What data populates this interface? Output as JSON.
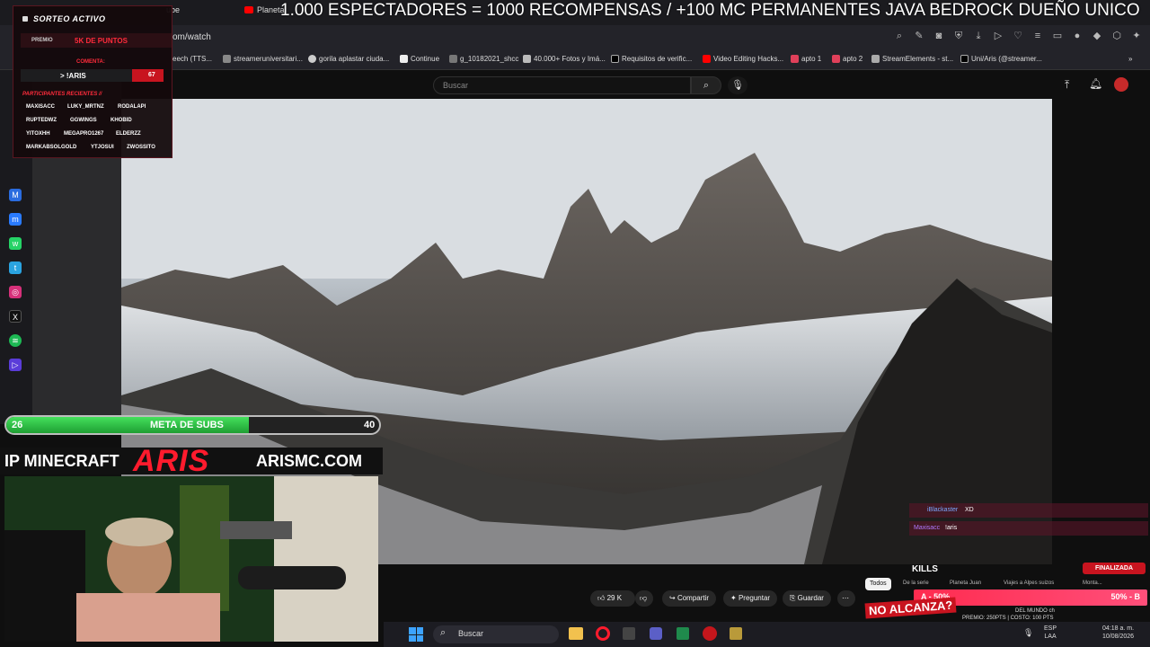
{
  "banner": "1.000 ESPECTADORES = 1000 RECOMPENSAS / +100 MC PERMANENTES JAVA BEDROCK DUEÑO UNICO",
  "tabs": [
    "ube",
    "Planeta"
  ],
  "url": "om/watch",
  "bookmarks": [
    "eech (TTS...",
    "streameruniversitari...",
    "gorila aplastar ciuda...",
    "Continue",
    "g_10182021_shcc",
    "40.000+ Fotos y Imá...",
    "Requisitos de verific...",
    "Video Editing Hacks...",
    "apto 1",
    "apto 2",
    "StreamElements - st...",
    "Uni/Aris (@streamer..."
  ],
  "youtube": {
    "search_placeholder": "Buscar"
  },
  "actions": {
    "likes": "29 K",
    "share": "Compartir",
    "ask": "Preguntar",
    "save": "Guardar"
  },
  "chips": [
    "Todos",
    "De la serie",
    "Planeta Juan",
    "Viajes a Alpes suizos",
    "Monta..."
  ],
  "sorteo": {
    "title": "SORTEO ACTIVO",
    "premio_label": "PREMIO",
    "premio_value": "5K DE PUNTOS",
    "comenta_label": "COMENTA:",
    "command": "> !ARIS",
    "count": "67",
    "participants_label": "PARTICIPANTES RECIENTES //",
    "participants": [
      "MAXISACC",
      "LUKY_MRTNZ",
      "RODALAPI",
      "RUPTEDWZ",
      "GGWINGS",
      "KHOBID",
      "YITOXHH",
      "MEGAPRO1267",
      "ELDERZZ",
      "MARKABSOLGOLD",
      "YTJOSUI",
      "ZWOSSITO"
    ]
  },
  "subs_goal": {
    "current": "26",
    "label": "META DE SUBS",
    "target": "40",
    "progress": 0.65
  },
  "ip_bar": {
    "left": "IP MINECRAFT",
    "logo": "ARIS",
    "right": "ARISMC.COM"
  },
  "chat": [
    {
      "user": "iBlackaster",
      "msg": "XD"
    },
    {
      "user": "Maxisacc",
      "msg": "!aris"
    }
  ],
  "kills": {
    "label": "KILLS",
    "status": "FINALIZADA",
    "left": "A - 50%",
    "right": "50% - B",
    "footer_left": "NO ALCANZA?",
    "footer_mid": "DEL MUNDO ch",
    "footer_cost": "PREMIO: 250PTS | COSTO: 100 PTS"
  },
  "taskbar": {
    "search": "Buscar",
    "lang": "ESP",
    "lang2": "LAA",
    "time": "04:18 a. m.",
    "date": "10/08/2026"
  },
  "colors": {
    "accent_red": "#ff2b3b",
    "subs_green": "#2fbf46",
    "youtube_red": "#ff0000"
  }
}
